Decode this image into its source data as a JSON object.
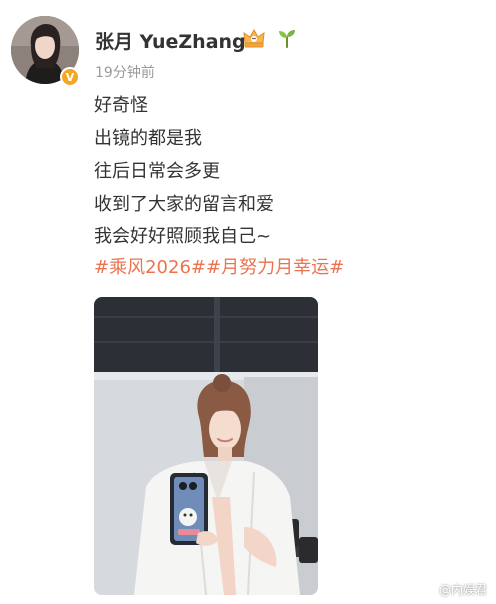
{
  "user": {
    "name": "张月 YueZhang",
    "verified_mark": "V",
    "timestamp": "19分钟前"
  },
  "badges": [
    {
      "icon": "crown-badge-icon"
    },
    {
      "icon": "sprout-badge-icon"
    }
  ],
  "post": {
    "lines": [
      "好奇怪",
      "出镜的都是我",
      "往后日常会多更",
      "收到了大家的留言和爱",
      "我会好好照顾我自己~"
    ],
    "hashtags": [
      "#乘风2026#",
      "#月努力月幸运#"
    ]
  },
  "photo": {
    "icon": "post-photo"
  },
  "watermark": {
    "text": "@内娱君",
    "icon": "weibo-logo-icon"
  },
  "colors": {
    "hashtag": "#eb7350",
    "verified": "#f5a623",
    "timestamp": "#9a9a9a",
    "text": "#333333"
  }
}
